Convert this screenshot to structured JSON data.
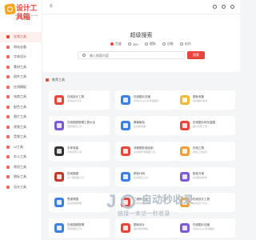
{
  "logo": {
    "text": "设计工具箱",
    "subtitle": "Be Creative Everyday"
  },
  "sidebar": {
    "items": [
      {
        "label": "在线工具",
        "active": true
      },
      {
        "label": "网站必备"
      },
      {
        "label": "字体设计"
      },
      {
        "label": "素材工具"
      },
      {
        "label": "插件工具"
      },
      {
        "label": "在线模板"
      },
      {
        "label": "电商工具"
      },
      {
        "label": "配色工具"
      },
      {
        "label": "图片工具"
      },
      {
        "label": "视频工具"
      },
      {
        "label": "音频工具"
      },
      {
        "label": "UI工具"
      },
      {
        "label": "办公工具"
      },
      {
        "label": "常用工具"
      },
      {
        "label": "图标工具"
      },
      {
        "label": "设计工具"
      }
    ]
  },
  "topbar": {
    "menu_icon": "≡"
  },
  "search": {
    "title": "超级搜索",
    "engines": [
      {
        "label": "百度",
        "selected": true
      },
      {
        "label": "360"
      },
      {
        "label": "搜狗"
      },
      {
        "label": "谷歌"
      },
      {
        "label": "站内"
      }
    ],
    "placeholder": "输入搜索内容",
    "button": "搜索"
  },
  "section": {
    "title": "推荐工具"
  },
  "cards": [
    {
      "title": "在线设计工具",
      "desc": "在线设计平台",
      "color": "#e8453c"
    },
    {
      "title": "在线图片压缩",
      "desc": "支持png,jpg,gif压缩图片",
      "color": "#3f7fe0"
    },
    {
      "title": "图标收集",
      "desc": "在线图标素材",
      "color": "#f0b93a"
    },
    {
      "title": "在线视频剪辑工具大全",
      "desc": "视频编辑工具",
      "color": "#7b5bd6"
    },
    {
      "title": "屏幕取色",
      "desc": "在线取色器",
      "color": "#3f7fe0"
    },
    {
      "title": "在线图片转矢量图",
      "desc": "图片转换工具",
      "color": "#e8453c"
    },
    {
      "title": "字体安装",
      "desc": "字体资源下载",
      "color": "#333333"
    },
    {
      "title": "流程图在线绘制",
      "desc": "在线制作流程图工具",
      "color": "#e8453c"
    },
    {
      "title": "在线工具",
      "desc": "常用工具集合",
      "color": "#f0a03a"
    },
    {
      "title": "在线抠图",
      "desc": "AI一键抠图工具",
      "color": "#c0392b"
    },
    {
      "title": "颜色代码",
      "desc": "在线配色工具",
      "color": "#3f7fe0"
    },
    {
      "title": "配色方案",
      "desc": "在线配色参考",
      "color": "#7b5bd6"
    },
    {
      "title": "思维导图",
      "desc": "在线思维导图",
      "color": "#3f7fe0"
    },
    {
      "title": "二维码生成",
      "desc": "在线生成二维码",
      "color": "#e8453c"
    },
    {
      "title": "在线设计工具",
      "desc": "在线设计平台",
      "color": "#f0a03a"
    },
    {
      "title": "在线视频剪辑",
      "desc": "视频编辑工具",
      "color": "#3f7fe0"
    },
    {
      "title": "图标设计",
      "desc": "图标素材网站",
      "color": "#e8453c"
    },
    {
      "title": "在线图片压缩",
      "desc": "支持png,jpg压缩图片",
      "color": "#7b5bd6"
    }
  ],
  "watermark": {
    "brand": "自动秒收录",
    "tagline": "链接一来访一秒收录"
  },
  "colors": {
    "accent": "#e8453c",
    "logo": "#f6a623"
  }
}
